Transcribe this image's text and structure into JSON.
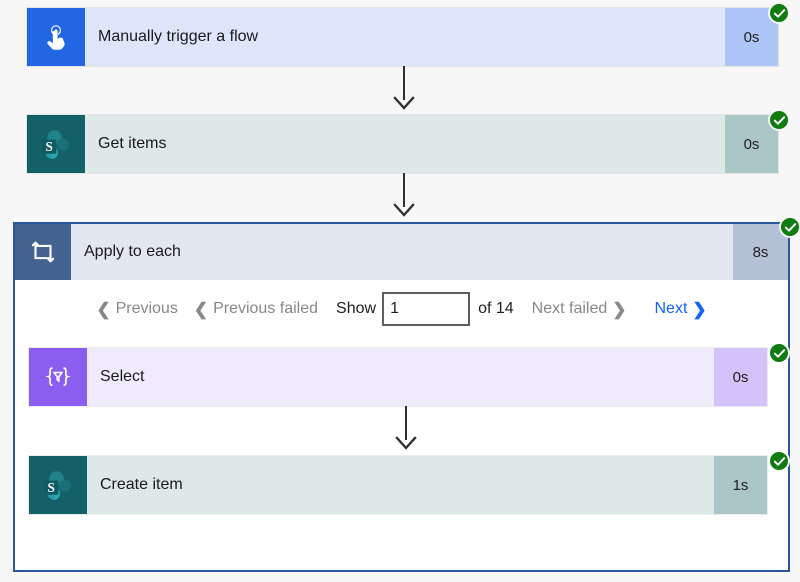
{
  "flow": {
    "nodes": [
      {
        "id": "manually-trigger-a-flow",
        "title": "Manually trigger a flow",
        "duration": "0s",
        "status": "succeeded",
        "icon": "tap-hand-icon",
        "icon_bg": "#2266e3",
        "body_bg": "#dde6fb",
        "duration_bg": "#adc6f7"
      },
      {
        "id": "get-items",
        "title": "Get items",
        "duration": "0s",
        "status": "succeeded",
        "icon": "sharepoint-icon",
        "icon_bg": "#136067",
        "body_bg": "#dde8e8",
        "duration_bg": "#aac6c6"
      }
    ],
    "scope": {
      "id": "apply-to-each",
      "title": "Apply to each",
      "duration": "8s",
      "status": "succeeded",
      "icon": "loop-icon",
      "icon_bg": "#44628f",
      "body_bg": "#e3e7f1",
      "duration_bg": "#b4c1d6",
      "border_color": "#2b579a",
      "pagination": {
        "previous_label": "Previous",
        "previous_failed_label": "Previous failed",
        "show_label": "Show",
        "page_value": "1",
        "page_placeholder": "1",
        "total_label": "of 14",
        "next_failed_label": "Next failed",
        "next_label": "Next",
        "prev_chevron": "❮",
        "next_chevron": "❯",
        "disabled_color": "#8a8886",
        "active_color": "#1264f5"
      },
      "children": [
        {
          "id": "select",
          "title": "Select",
          "duration": "0s",
          "status": "succeeded",
          "icon": "select-braces-filter-icon",
          "icon_bg": "#8c5ef0",
          "body_bg": "#f0eafd",
          "duration_bg": "#d4c2fa"
        },
        {
          "id": "create-item",
          "title": "Create item",
          "duration": "1s",
          "status": "succeeded",
          "icon": "sharepoint-icon",
          "icon_bg": "#136067",
          "body_bg": "#dde8e8",
          "duration_bg": "#aac6c6"
        }
      ]
    },
    "status_colors": {
      "succeeded": "#107c10"
    }
  }
}
